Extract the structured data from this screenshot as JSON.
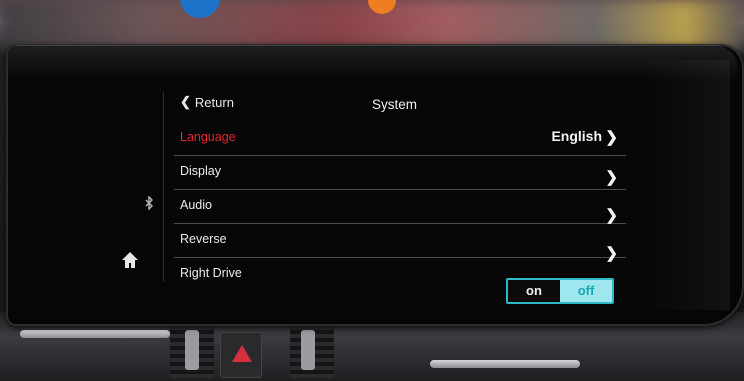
{
  "header": {
    "back_label": "Return",
    "title": "System"
  },
  "menu": {
    "items": [
      {
        "label": "Language",
        "value": "English",
        "active": true
      },
      {
        "label": "Display",
        "value": "",
        "active": false
      },
      {
        "label": "Audio",
        "value": "",
        "active": false
      },
      {
        "label": "Reverse",
        "value": "",
        "active": false
      },
      {
        "label": "Right Drive",
        "value": "",
        "active": false
      }
    ]
  },
  "right_drive_toggle": {
    "on_label": "on",
    "off_label": "off",
    "selected": "off"
  },
  "icons": {
    "back": "chevron-left-icon",
    "row_arrow": "chevron-right-icon",
    "bluetooth": "bluetooth-icon",
    "home": "home-icon"
  },
  "colors": {
    "active_text": "#e3262d",
    "toggle_accent": "#2fb9c4",
    "toggle_selected_bg": "#9fe7ee"
  }
}
